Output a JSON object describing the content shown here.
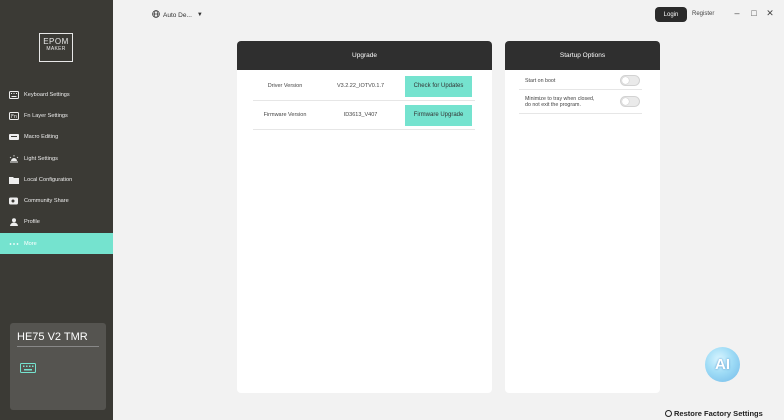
{
  "brand": {
    "logo_line1": "EPOM",
    "logo_line2": "MAKER"
  },
  "sidebar": {
    "items": [
      {
        "label": "Keyboard Settings",
        "icon": "keyboard-icon",
        "active": false
      },
      {
        "label": "Fn Layer Settings",
        "icon": "fn-icon",
        "active": false
      },
      {
        "label": "Macro Editing",
        "icon": "macro-icon",
        "active": false
      },
      {
        "label": "Light Settings",
        "icon": "light-icon",
        "active": false
      },
      {
        "label": "Local Configuration",
        "icon": "folder-icon",
        "active": false
      },
      {
        "label": "Community Share",
        "icon": "share-icon",
        "active": false
      },
      {
        "label": "Profile",
        "icon": "user-icon",
        "active": false
      },
      {
        "label": "More",
        "icon": "dots-icon",
        "active": true
      }
    ],
    "device": {
      "name": "HE75 V2 TMR",
      "icon": "keyboard-icon"
    }
  },
  "topbar": {
    "language": "Auto De...",
    "login": "Login",
    "register": "Register",
    "minimize": "–",
    "maximize": "□",
    "close": "✕"
  },
  "upgrade": {
    "title": "Upgrade",
    "rows": [
      {
        "label": "Driver Version",
        "value": "V3.2.22_IOTV0.1.7",
        "button": "Check for Updates"
      },
      {
        "label": "Firmware Version",
        "value": "ID3613_V407",
        "button": "Firmware Upgrade"
      }
    ]
  },
  "startup": {
    "title": "Startup Options",
    "options": [
      {
        "label": "Start on boot",
        "enabled": false
      },
      {
        "label_line1": "Minimize to tray when closed,",
        "label_line2": "do not exit the program.",
        "enabled": false
      }
    ]
  },
  "ai_button": "AI",
  "restore": "Restore Factory Settings",
  "colors": {
    "accent": "#75e3cf",
    "sidebar": "#3b3a35",
    "header": "#2f2f2f"
  }
}
